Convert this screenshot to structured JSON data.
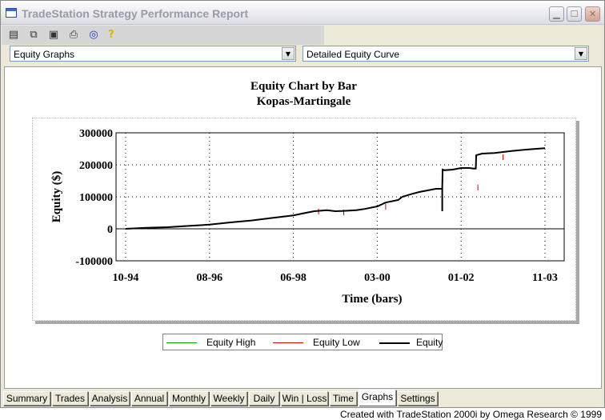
{
  "window": {
    "title": "TradeStation Strategy Performance Report"
  },
  "toolbar": {
    "icons": [
      "properties-icon",
      "copy-icon",
      "save-icon",
      "print-icon",
      "target-icon",
      "help-icon"
    ]
  },
  "selectors": {
    "left": "Equity Graphs",
    "right": "Detailed Equity Curve"
  },
  "chart_data": {
    "type": "line",
    "title": "Equity Chart by Bar",
    "subtitle": "Kopas-Martingale",
    "xlabel": "Time (bars)",
    "ylabel": "Equity ($)",
    "x_ticks": [
      "10-94",
      "08-96",
      "06-98",
      "03-00",
      "01-02",
      "11-03"
    ],
    "y_ticks": [
      "-100000",
      "0",
      "100000",
      "200000",
      "300000"
    ],
    "ylim": [
      -100000,
      300000
    ],
    "grid": true,
    "legend": "bottom",
    "series": [
      {
        "name": "Equity High",
        "color": "#00a000"
      },
      {
        "name": "Equity Low",
        "color": "#e00000"
      },
      {
        "name": "Equity",
        "color": "#000000",
        "x": [
          0,
          0.05,
          0.1,
          0.15,
          0.2,
          0.25,
          0.3,
          0.35,
          0.4,
          0.43,
          0.45,
          0.48,
          0.5,
          0.52,
          0.55,
          0.57,
          0.6,
          0.62,
          0.65,
          0.66,
          0.68,
          0.7,
          0.72,
          0.74,
          0.755,
          0.756,
          0.76,
          0.78,
          0.8,
          0.82,
          0.83,
          0.835,
          0.836,
          0.85,
          0.88,
          0.9,
          0.92,
          0.95,
          0.98,
          1.0
        ],
        "y": [
          0,
          3000,
          5000,
          9000,
          13000,
          20000,
          26000,
          34000,
          42000,
          50000,
          55000,
          58000,
          55000,
          56000,
          58000,
          62000,
          70000,
          82000,
          90000,
          100000,
          108000,
          115000,
          120000,
          125000,
          125000,
          185000,
          183000,
          185000,
          190000,
          190000,
          188000,
          188000,
          230000,
          235000,
          237000,
          240000,
          243000,
          247000,
          250000,
          252000
        ]
      }
    ]
  },
  "tabs": [
    "Summary",
    "Trades",
    "Analysis",
    "Annual",
    "Monthly",
    "Weekly",
    "Daily",
    "Win | Loss",
    "Time",
    "Graphs",
    "Settings"
  ],
  "active_tab": "Graphs",
  "footer": {
    "text": "Created with TradeStation 2000i by Omega Research © 1999"
  }
}
